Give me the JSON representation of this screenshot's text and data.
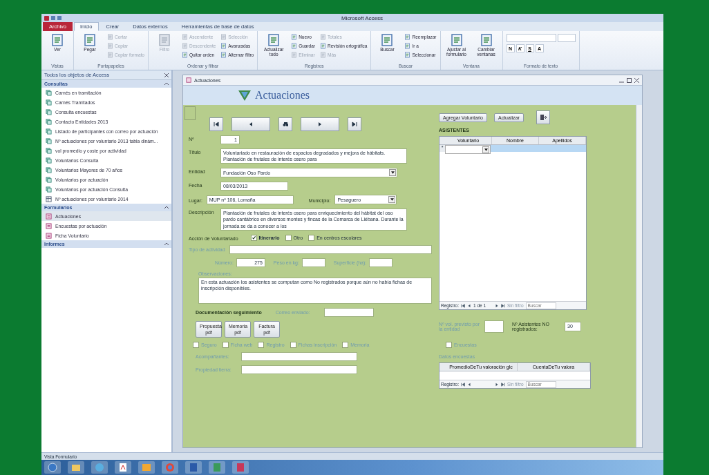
{
  "window": {
    "title": "Microsoft Access"
  },
  "ribbon_tabs": [
    {
      "label": "Archivo",
      "selected": false,
      "kind": "file"
    },
    {
      "label": "Inicio",
      "selected": true,
      "kind": "tab"
    },
    {
      "label": "Crear",
      "selected": false,
      "kind": "tab"
    },
    {
      "label": "Datos externos",
      "selected": false,
      "kind": "tab"
    },
    {
      "label": "Herramientas de base de datos",
      "selected": false,
      "kind": "tab"
    }
  ],
  "ribbon_groups": [
    {
      "label": "Vistas",
      "items": [
        {
          "label": "Ver",
          "kind": "large",
          "disabled": false
        }
      ]
    },
    {
      "label": "Portapapeles",
      "items": [
        {
          "label": "Pegar",
          "kind": "large",
          "disabled": false
        },
        {
          "label": "Cortar",
          "kind": "small",
          "disabled": true
        },
        {
          "label": "Copiar",
          "kind": "small",
          "disabled": true
        },
        {
          "label": "Copiar formato",
          "kind": "small",
          "disabled": true
        }
      ]
    },
    {
      "label": "Ordenar y filtrar",
      "items": [
        {
          "label": "Filtro",
          "kind": "large",
          "disabled": true
        },
        {
          "label": "Ascendente",
          "kind": "small",
          "disabled": true
        },
        {
          "label": "Descendente",
          "kind": "small",
          "disabled": true
        },
        {
          "label": "Quitar orden",
          "kind": "small",
          "disabled": false
        },
        {
          "label": "Selección",
          "kind": "small",
          "disabled": true
        },
        {
          "label": "Avanzadas",
          "kind": "small",
          "disabled": false
        },
        {
          "label": "Alternar filtro",
          "kind": "small",
          "disabled": false
        }
      ]
    },
    {
      "label": "Registros",
      "items": [
        {
          "label": "Actualizar todo",
          "kind": "large",
          "disabled": false
        },
        {
          "label": "Nuevo",
          "kind": "small",
          "disabled": false
        },
        {
          "label": "Guardar",
          "kind": "small",
          "disabled": false
        },
        {
          "label": "Eliminar",
          "kind": "small",
          "disabled": true
        },
        {
          "label": "Totales",
          "kind": "small",
          "disabled": true
        },
        {
          "label": "Revisión ortográfica",
          "kind": "small",
          "disabled": false
        },
        {
          "label": "Más",
          "kind": "small",
          "disabled": true
        }
      ]
    },
    {
      "label": "Buscar",
      "items": [
        {
          "label": "Buscar",
          "kind": "large",
          "disabled": false
        },
        {
          "label": "Reemplazar",
          "kind": "small",
          "disabled": false
        },
        {
          "label": "Ir a",
          "kind": "small",
          "disabled": false
        },
        {
          "label": "Seleccionar",
          "kind": "small",
          "disabled": false
        }
      ]
    },
    {
      "label": "Ventana",
      "items": [
        {
          "label": "Ajustar al formulario",
          "kind": "large",
          "disabled": false
        },
        {
          "label": "Cambiar ventanas",
          "kind": "large",
          "disabled": false
        }
      ]
    },
    {
      "label": "Formato de texto",
      "format_buttons": [
        "N",
        "K",
        "S",
        "A"
      ]
    }
  ],
  "nav_pane": {
    "title": "Todos los objetos de Access",
    "groups": [
      {
        "label": "Consultas",
        "items": [
          {
            "label": "Carnés en tramitación",
            "kind": "query",
            "selected": false
          },
          {
            "label": "Carnés Tramitados",
            "kind": "query",
            "selected": false
          },
          {
            "label": "Consulta encuestas",
            "kind": "query",
            "selected": false
          },
          {
            "label": "Contacto Entidades 2013",
            "kind": "query",
            "selected": false
          },
          {
            "label": "Listado de participantes con correo por actuación",
            "kind": "query",
            "selected": false
          },
          {
            "label": "Nº actuaciones por voluntario 2013 tabla dinám...",
            "kind": "query",
            "selected": false
          },
          {
            "label": "vol promedio y coste por actividad",
            "kind": "query",
            "selected": false
          },
          {
            "label": "Voluntarios Consulta",
            "kind": "query",
            "selected": false
          },
          {
            "label": "Voluntarios Mayores de 70 años",
            "kind": "query",
            "selected": false
          },
          {
            "label": "Voluntarios por actuación",
            "kind": "query",
            "selected": false
          },
          {
            "label": "Voluntarios por actuación Consulta",
            "kind": "query",
            "selected": false
          },
          {
            "label": "Nº actuaciones por voluntario 2014",
            "kind": "pivot",
            "selected": false
          }
        ]
      },
      {
        "label": "Formularios",
        "items": [
          {
            "label": "Actuaciones",
            "kind": "form",
            "selected": true
          },
          {
            "label": "Encuestas por actuación",
            "kind": "form",
            "selected": false
          },
          {
            "label": "Ficha Voluntario",
            "kind": "form",
            "selected": false
          }
        ]
      },
      {
        "label": "Informes"
      }
    ]
  },
  "form": {
    "tab_title": "Actuaciones",
    "header": "Actuaciones",
    "record_buttons": [
      {
        "kind": "first"
      },
      {
        "kind": "previous"
      },
      {
        "kind": "find"
      },
      {
        "kind": "next"
      },
      {
        "kind": "last"
      }
    ],
    "numero": {
      "label": "Nº",
      "value": "1"
    },
    "titulo": {
      "label": "Título",
      "value": "Voluntariado en restauración de espacios degradados y mejora de hábitats. Plantación de frutales de interés osero para"
    },
    "entidad": {
      "label": "Entidad",
      "value": "Fundación Oso Pardo"
    },
    "fecha": {
      "label": "Fecha",
      "value": "08/03/2013"
    },
    "lugar": {
      "label": "Lugar:",
      "value": "MUP nº 106, Lomaña"
    },
    "municipio": {
      "label": "Municipio:",
      "value": "Pesaguero"
    },
    "descripcion": {
      "label": "Descripción",
      "value": "Plantación de frutales de interés osero para enriquecimiento del hábitat del oso pardo cantábrico en diversos montes y fincas de la Comarca de Liébana. Durante la jornada se da a conocer a los"
    },
    "accion": {
      "label": "Acción de Voluntariado",
      "options": [
        {
          "label": "Itinerario",
          "checked": true
        },
        {
          "label": "Otro",
          "checked": false
        },
        {
          "label": "En centros escolares",
          "checked": false
        }
      ]
    },
    "tipo_actividad": {
      "label": "Tipo de actividad"
    },
    "measures": [
      {
        "label": "Número:",
        "value": "275"
      },
      {
        "label": "Peso en kg:"
      },
      {
        "label": "Superficie (ha):"
      }
    ],
    "observaciones": {
      "label": "Observaciones:",
      "value": "En esta actuación los asistentes se computan como No registrados porque aún no había fichas de inscripción disponibles."
    },
    "documentacion": {
      "label": "Documentación seguimiento",
      "field_label": "Correo enviado:"
    },
    "doc_buttons": [
      "Propuesta pdf",
      "Memoria pdf",
      "Factura pdf"
    ],
    "doc_checks": [
      {
        "label": "Seguro",
        "checked": false
      },
      {
        "label": "Ficha web",
        "checked": false
      },
      {
        "label": "Registro",
        "checked": false
      },
      {
        "label": "Fichas inscripción",
        "checked": false
      },
      {
        "label": "Memoria",
        "checked": false
      }
    ],
    "extra_fields": [
      {
        "label": "Acompañantes:"
      },
      {
        "label": "Propiedad tierra:"
      }
    ],
    "actions": [
      "Agregar Voluntario",
      "Actualizar"
    ],
    "asistentes": {
      "title": "ASISTENTES",
      "columns": [
        "Voluntario",
        "Nombre",
        "Apellidos"
      ],
      "new_row_marker": "*",
      "navigator": {
        "prefix": "Registro:",
        "position": "1 de 1",
        "filter": "Sin filtro",
        "placeholder": "Buscar"
      }
    },
    "previstos": {
      "label": "Nº vol. previsto por la entidad"
    },
    "no_registrados": {
      "label": "Nº Asistentes NO registrados:",
      "value": "30"
    },
    "encuestas": {
      "label": "Encuestas",
      "checked": false
    },
    "datos_encuestas": {
      "title": "Datos encuestas",
      "columns": [
        "PromedioDeTu valoración glc",
        "CuentaDeTu valora"
      ],
      "navigator": {
        "prefix": "Registro:",
        "filter": "Sin filtro",
        "placeholder": "Buscar"
      }
    }
  },
  "status_bar": {
    "text": "Vista Formulario"
  }
}
